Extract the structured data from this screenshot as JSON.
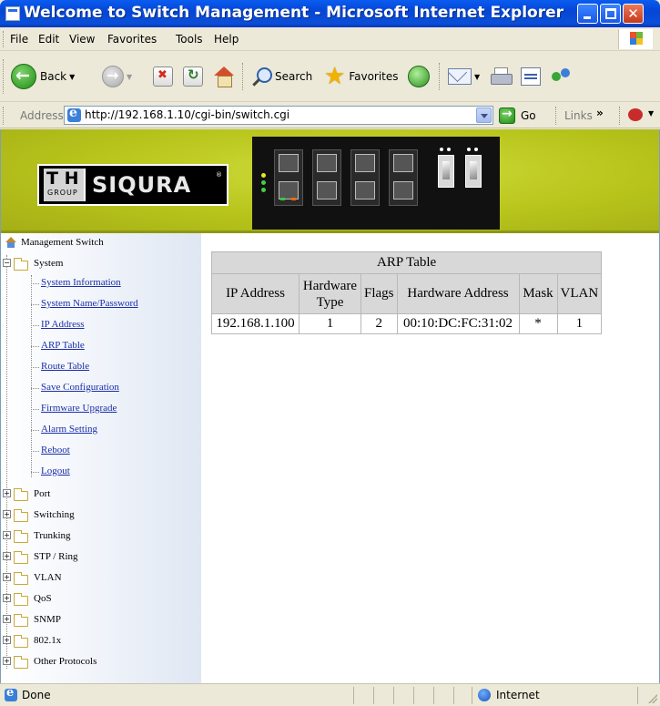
{
  "window": {
    "title": "Welcome to Switch Management - Microsoft Internet Explorer",
    "controls": [
      "minimize",
      "maximize",
      "close"
    ]
  },
  "menubar": {
    "items": [
      "File",
      "Edit",
      "View",
      "Favorites",
      "Tools",
      "Help"
    ]
  },
  "toolbar": {
    "back_label": "Back",
    "search_label": "Search",
    "favorites_label": "Favorites"
  },
  "addressbar": {
    "label": "Address",
    "url": "http://192.168.1.10/cgi-bin/switch.cgi",
    "go_label": "Go",
    "links_label": "Links",
    "links_chevron": "»"
  },
  "banner": {
    "logo_th": "T H",
    "logo_group": "GROUP",
    "logo_brand": "SIQURA",
    "logo_reg": "®"
  },
  "sidebar": {
    "root_label": "Management Switch",
    "system_label": "System",
    "system_items": [
      "System Information",
      "System Name/Password",
      "IP Address",
      "ARP Table",
      "Route Table",
      "Save Configuration",
      "Firmware Upgrade",
      "Alarm Setting",
      "Reboot",
      "Logout"
    ],
    "folders": [
      "Port",
      "Switching",
      "Trunking",
      "STP / Ring",
      "VLAN",
      "QoS",
      "SNMP",
      "802.1x",
      "Other Protocols"
    ]
  },
  "arp_table": {
    "caption": "ARP Table",
    "headers": [
      "IP Address",
      "Hardware Type",
      "Flags",
      "Hardware Address",
      "Mask",
      "VLAN"
    ],
    "rows": [
      [
        "192.168.1.100",
        "1",
        "2",
        "00:10:DC:FC:31:02",
        "*",
        "1"
      ]
    ]
  },
  "statusbar": {
    "status": "Done",
    "zone": "Internet"
  },
  "colors": {
    "titlebar": "#0a4fd8",
    "banner": "#b7c41b",
    "link": "#1a2ea8",
    "table_header": "#d8d8d8"
  }
}
